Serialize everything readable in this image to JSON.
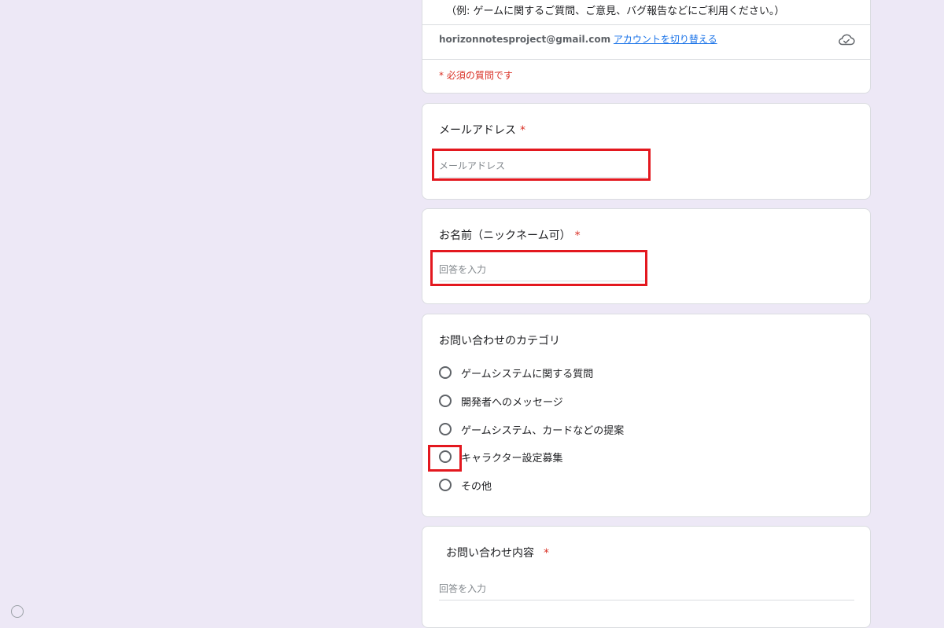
{
  "header": {
    "description": "（例: ゲームに関するご質問、ご意見、バグ報告などにご利用ください。）",
    "account_email": "horizonnotesproject@gmail.com",
    "switch_account_label": "アカウントを切り替える",
    "required_note": "* 必須の質問です"
  },
  "questions": {
    "email": {
      "title": "メールアドレス",
      "required_mark": "*",
      "placeholder": "メールアドレス"
    },
    "name": {
      "title": "お名前（ニックネーム可）",
      "required_mark": "*",
      "placeholder": "回答を入力"
    },
    "category": {
      "title": "お問い合わせのカテゴリ",
      "options": [
        {
          "label": "ゲームシステムに関する質問"
        },
        {
          "label": "開発者へのメッセージ"
        },
        {
          "label": "ゲームシステム、カードなどの提案"
        },
        {
          "label": "キャラクター設定募集"
        },
        {
          "label": "その他"
        }
      ]
    },
    "content": {
      "title": "お問い合わせ内容",
      "required_mark": "*",
      "placeholder": "回答を入力"
    }
  },
  "icons": {
    "cloud": "cloud-saved-icon",
    "radio": "radio-button-icon"
  },
  "colors": {
    "background": "#ede8f6",
    "required": "#d93025",
    "link": "#1a73e8",
    "highlight": "#e3181f"
  }
}
